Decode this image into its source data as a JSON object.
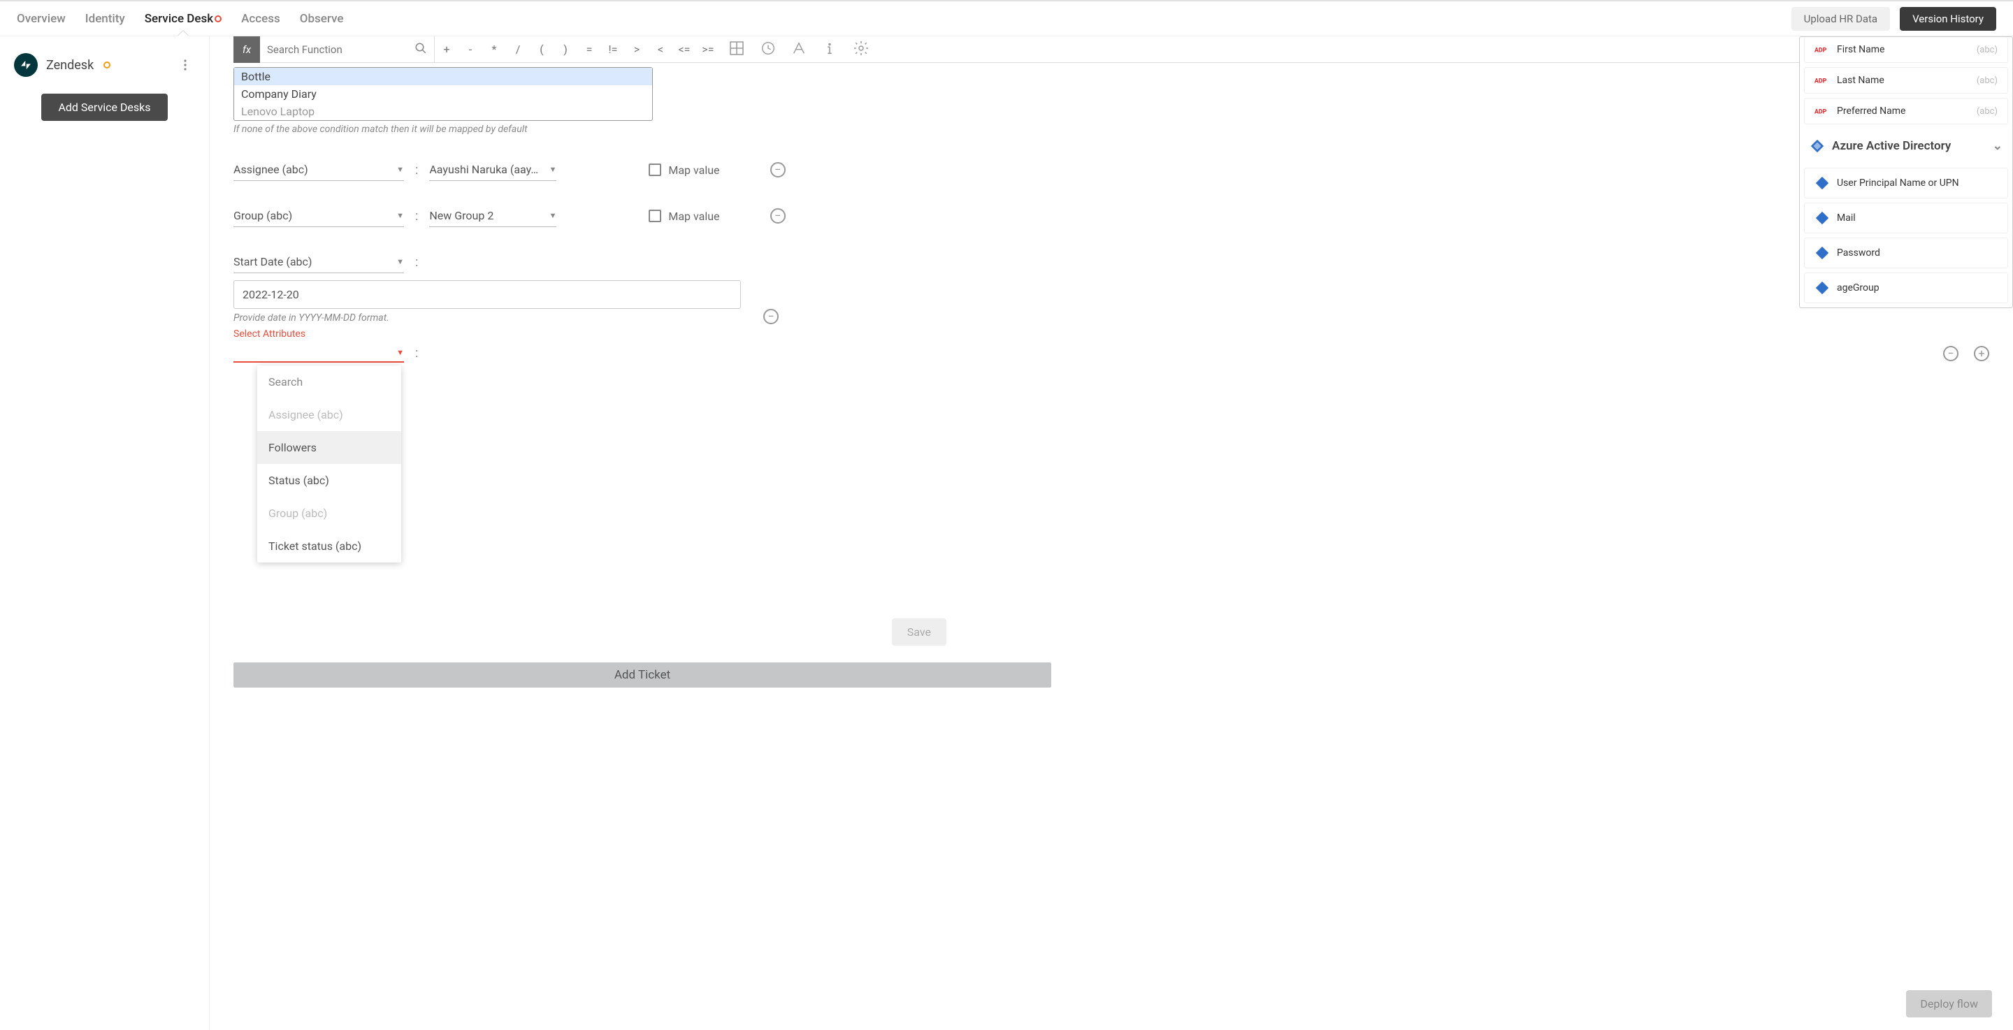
{
  "nav": {
    "tabs": [
      "Overview",
      "Identity",
      "Service Desk",
      "Access",
      "Observe"
    ],
    "active_index": 2,
    "upload_btn": "Upload HR Data",
    "version_btn": "Version History"
  },
  "sidebar": {
    "service_desk_name": "Zendesk",
    "add_btn": "Add Service Desks"
  },
  "formula_bar": {
    "fx_label": "fx",
    "search_placeholder": "Search Function",
    "operators": [
      "+",
      "-",
      "*",
      "/",
      "(",
      ")",
      "=",
      "!=",
      ">",
      "<",
      "<=",
      ">="
    ]
  },
  "listbox": {
    "items": [
      "Bottle",
      "Company Diary",
      "Lenovo Laptop"
    ],
    "selected_index": 0,
    "helper": "If none of the above condition match then it will be mapped by default"
  },
  "mappings": [
    {
      "left": "Assignee (abc)",
      "right": "Aayushi Naruka (aay…",
      "checkbox_label": "Map value"
    },
    {
      "left": "Group (abc)",
      "right": "New Group 2",
      "checkbox_label": "Map value"
    }
  ],
  "date_block": {
    "label": "Start Date (abc)",
    "value": "2022-12-20",
    "helper": "Provide date in YYYY-MM-DD format.",
    "error": "Select Attributes"
  },
  "dropdown": {
    "search_label": "Search",
    "items": [
      {
        "label": "Assignee (abc)",
        "disabled": true
      },
      {
        "label": "Followers",
        "disabled": false,
        "hover": true
      },
      {
        "label": "Status (abc)",
        "disabled": false
      },
      {
        "label": "Group (abc)",
        "disabled": true
      },
      {
        "label": "Ticket status (abc)",
        "disabled": false
      }
    ]
  },
  "right_panel": {
    "adp_rows": [
      {
        "label": "First Name",
        "type": "(abc)"
      },
      {
        "label": "Last Name",
        "type": "(abc)"
      },
      {
        "label": "Preferred Name",
        "type": "(abc)"
      }
    ],
    "aad_header": "Azure Active Directory",
    "aad_rows": [
      {
        "label": "User Principal Name or UPN"
      },
      {
        "label": "Mail"
      },
      {
        "label": "Password"
      },
      {
        "label": "ageGroup"
      }
    ]
  },
  "buttons": {
    "save": "Save",
    "add_ticket": "Add Ticket",
    "deploy": "Deploy flow"
  }
}
